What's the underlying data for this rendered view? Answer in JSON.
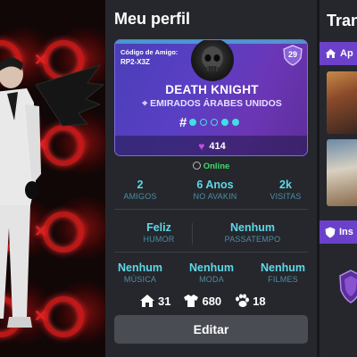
{
  "profile_panel": {
    "title": "Meu perfil",
    "card": {
      "friend_code_label": "Código de Amigo:",
      "friend_code": "RP2-X3Z",
      "level": "29",
      "username": "DEATH KNIGHT",
      "location": "EMIRADOS ÁRABES UNIDOS",
      "tag_symbol": "#",
      "likes": "414"
    },
    "status": "Online",
    "stats_row1": [
      {
        "value": "2",
        "label": "AMIGOS"
      },
      {
        "value": "6 Anos",
        "label": "NO AVAKIN"
      },
      {
        "value": "2k",
        "label": "VISITAS"
      }
    ],
    "stats_row2": [
      {
        "value": "Feliz",
        "label": "HUMOR"
      },
      {
        "value": "Nenhum",
        "label": "PASSATEMPO"
      }
    ],
    "stats_row3": [
      {
        "value": "Nenhum",
        "label": "MÚSICA"
      },
      {
        "value": "Nenhum",
        "label": "MODA"
      },
      {
        "value": "Nenhum",
        "label": "FILMES"
      }
    ],
    "counters": [
      {
        "icon": "house-icon",
        "value": "31"
      },
      {
        "icon": "shirt-icon",
        "value": "680"
      },
      {
        "icon": "paw-icon",
        "value": "18"
      }
    ],
    "edit_label": "Editar"
  },
  "right_panel": {
    "title": "Tran",
    "tab1": "Ap",
    "tab2": "Ins"
  },
  "colors": {
    "accent_purple": "#6b41c9",
    "teal": "#5fd8e8",
    "online_green": "#3fdc6a",
    "heart": "#c94de0"
  }
}
